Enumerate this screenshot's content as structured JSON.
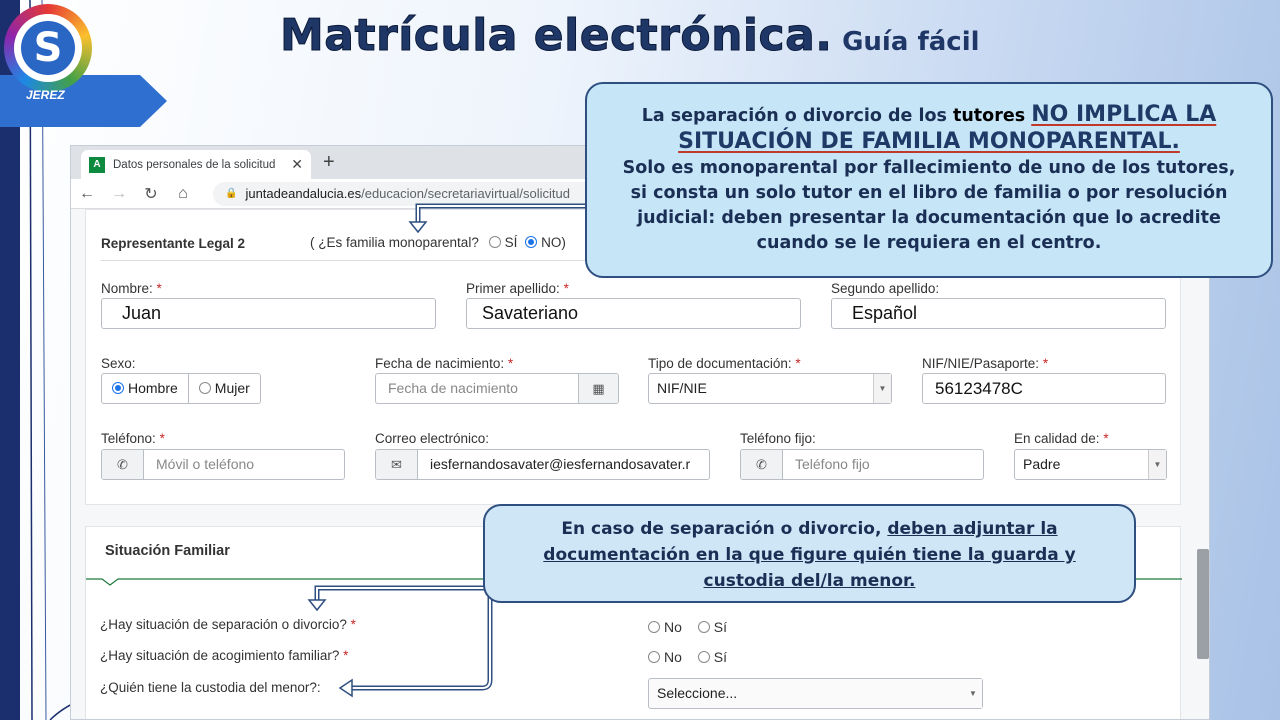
{
  "slide": {
    "title_main": "Matrícula electrónica.",
    "title_sub": "Guía fácil",
    "logo_text": "JEREZ",
    "logo_letter": "S"
  },
  "browser": {
    "tab_title": "Datos personales de la solicitud",
    "tab_favicon": "A",
    "url_host": "juntadeandalucia.es",
    "url_path": "/educacion/secretariavirtual/solicitud"
  },
  "representante": {
    "heading": "Representante Legal 2",
    "monoparental_question": "( ¿Es familia monoparental?",
    "opt_si": "SÍ",
    "opt_no": "NO)",
    "selected": "NO",
    "nombre_label": "Nombre:",
    "nombre_value": "Juan",
    "primer_apellido_label": "Primer apellido:",
    "primer_apellido_value": "Savateriano",
    "segundo_apellido_label": "Segundo apellido:",
    "segundo_apellido_value": "Español",
    "sexo_label": "Sexo:",
    "sexo_hombre": "Hombre",
    "sexo_mujer": "Mujer",
    "sexo_selected": "Hombre",
    "fecha_label": "Fecha de nacimiento:",
    "fecha_placeholder": "Fecha de nacimiento",
    "tipo_doc_label": "Tipo de documentación:",
    "tipo_doc_value": "NIF/NIE",
    "nif_label": "NIF/NIE/Pasaporte:",
    "nif_value": "56123478C",
    "telefono_label": "Teléfono:",
    "telefono_placeholder": "Móvil o teléfono",
    "correo_label": "Correo electrónico:",
    "correo_value": "iesfernandosavater@iesfernandosavater.r",
    "telefono_fijo_label": "Teléfono fijo:",
    "telefono_fijo_placeholder": "Teléfono fijo",
    "calidad_label": "En calidad de:",
    "calidad_value": "Padre",
    "required_mark": "*"
  },
  "situacion": {
    "heading": "Situación Familiar",
    "q_separacion": "¿Hay situación de separación o divorcio?",
    "q_acogimiento": "¿Hay situación de acogimiento familiar?",
    "q_custodia": "¿Quién tiene la custodia del menor?:",
    "opt_no": "No",
    "opt_si": "Sí",
    "custodia_placeholder": "Seleccione..."
  },
  "callout_top": {
    "line1_a": "La separación o divorcio de los",
    "line1_b": "tutores",
    "line1_c": "NO IMPLICA LA",
    "line2": "SITUACIÓN DE FAMILIA MONOPARENTAL.",
    "line3": "Solo es monoparental por fallecimiento de uno de los tutores,",
    "line4": "si consta un solo tutor en el libro de familia o por resolución",
    "line5": "judicial: deben presentar la documentación  que lo acredite",
    "line6": "cuando se le requiera en el centro."
  },
  "callout_bottom": {
    "line1_a": "En caso de separación o divorcio,",
    "line1_b": "deben adjuntar la",
    "line2": "documentación  en la que figure quién tiene la guarda y",
    "line3": "custodia del/la menor."
  },
  "colors": {
    "title": "#1f3766",
    "callout_bg": "#c6e6f8",
    "callout_border": "#2f4f80",
    "accent_red": "#c0392b",
    "sidebar": "#1b2f6e"
  }
}
